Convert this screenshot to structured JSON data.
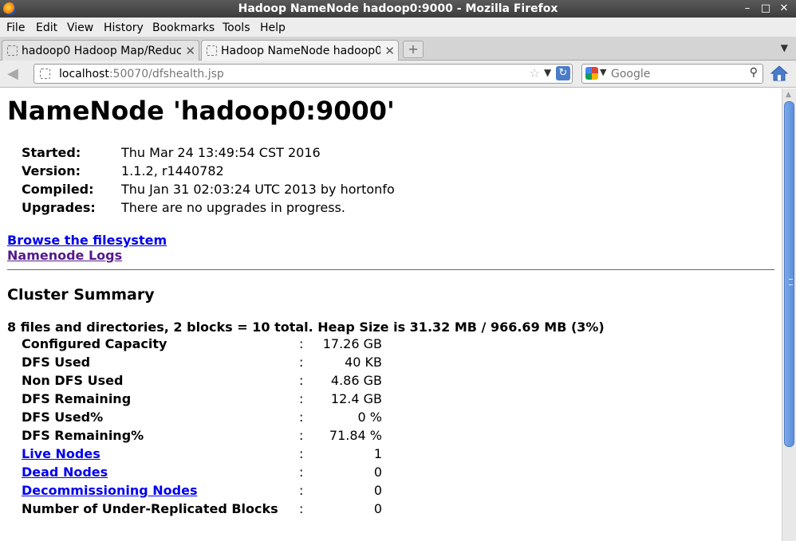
{
  "window": {
    "title": "Hadoop NameNode hadoop0:9000 - Mozilla Firefox"
  },
  "menu": [
    "File",
    "Edit",
    "View",
    "History",
    "Bookmarks",
    "Tools",
    "Help"
  ],
  "tabs": [
    {
      "label": "hadoop0 Hadoop Map/Reduc...",
      "active": false
    },
    {
      "label": "Hadoop NameNode hadoop0...",
      "active": true
    }
  ],
  "nav": {
    "url_host": "localhost",
    "url_rest": ":50070/dfshealth.jsp",
    "search_placeholder": "Google"
  },
  "page": {
    "title": "NameNode 'hadoop0:9000'",
    "info": [
      {
        "label": "Started:",
        "value": "Thu Mar 24 13:49:54 CST 2016"
      },
      {
        "label": "Version:",
        "value": "1.1.2, r1440782"
      },
      {
        "label": "Compiled:",
        "value": "Thu Jan 31 02:03:24 UTC 2013 by hortonfo"
      },
      {
        "label": "Upgrades:",
        "value": "There are no upgrades in progress."
      }
    ],
    "links": [
      {
        "label": "Browse the filesystem",
        "color": "#0000ee"
      },
      {
        "label": "Namenode Logs",
        "color": "#551a8b"
      }
    ],
    "cluster_heading": "Cluster Summary",
    "summary_line": "8 files and directories, 2 blocks = 10 total. Heap Size is 31.32 MB / 966.69 MB (3%)",
    "separator": ":",
    "stats": [
      {
        "label": "Configured Capacity",
        "value": "17.26 GB",
        "link": false
      },
      {
        "label": "DFS Used",
        "value": "40 KB",
        "link": false
      },
      {
        "label": "Non DFS Used",
        "value": "4.86 GB",
        "link": false
      },
      {
        "label": "DFS Remaining",
        "value": "12.4 GB",
        "link": false
      },
      {
        "label": "DFS Used%",
        "value": "0 %",
        "link": false
      },
      {
        "label": "DFS Remaining%",
        "value": "71.84 %",
        "link": false
      },
      {
        "label": "Live Nodes",
        "value": "1",
        "link": true
      },
      {
        "label": "Dead Nodes",
        "value": "0",
        "link": true
      },
      {
        "label": "Decommissioning Nodes",
        "value": "0",
        "link": true
      },
      {
        "label": "Number of Under-Replicated Blocks",
        "value": "0",
        "link": false
      }
    ]
  }
}
